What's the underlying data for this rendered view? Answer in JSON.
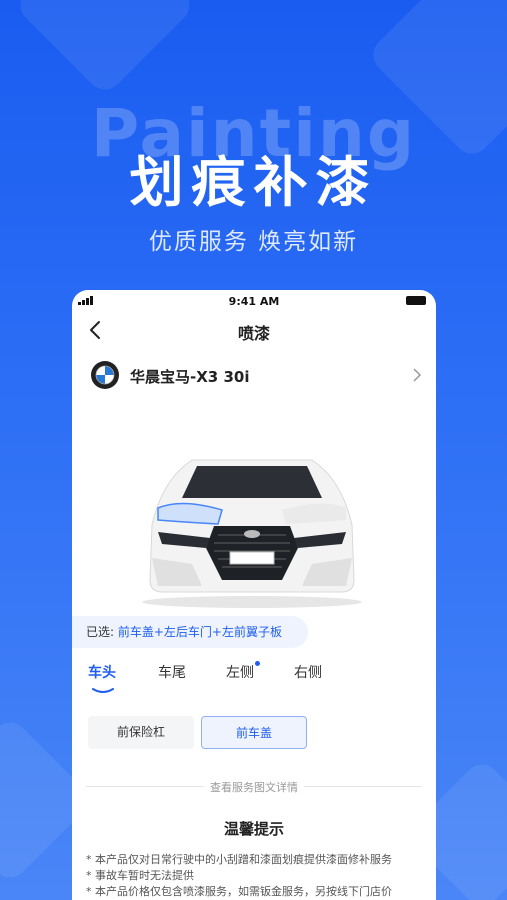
{
  "banner": {
    "ghost_text": "Painting",
    "headline": "划痕补漆",
    "subheadline": "优质服务 焕亮如新"
  },
  "status_bar": {
    "time": "9:41 AM"
  },
  "nav": {
    "title": "喷漆"
  },
  "car": {
    "name": "华晨宝马-X3 30i"
  },
  "selection": {
    "label": "已选:",
    "value": "前车盖+左后车门+左前翼子板"
  },
  "tabs": [
    {
      "label": "车头",
      "active": true
    },
    {
      "label": "车尾",
      "active": false
    },
    {
      "label": "左侧",
      "active": false,
      "has_dot": true
    },
    {
      "label": "右侧",
      "active": false
    }
  ],
  "parts": [
    {
      "label": "前保险杠",
      "active": false
    },
    {
      "label": "前车盖",
      "active": true
    }
  ],
  "details_link": "查看服务图文详情",
  "tips": {
    "title": "温馨提示",
    "items": [
      "* 本产品仅对日常行驶中的小刮蹭和漆面划痕提供漆面修补服务",
      "* 事故车暂时无法提供",
      "* 本产品价格仅包含喷漆服务，如需钣金服务，另按线下门店价"
    ]
  },
  "colors": {
    "accent": "#1f5ef0",
    "background": "#1a5cf0"
  },
  "icons": [
    "back-arrow-icon",
    "bmw-logo-icon",
    "chevron-right-icon",
    "signal-icon",
    "battery-icon"
  ]
}
